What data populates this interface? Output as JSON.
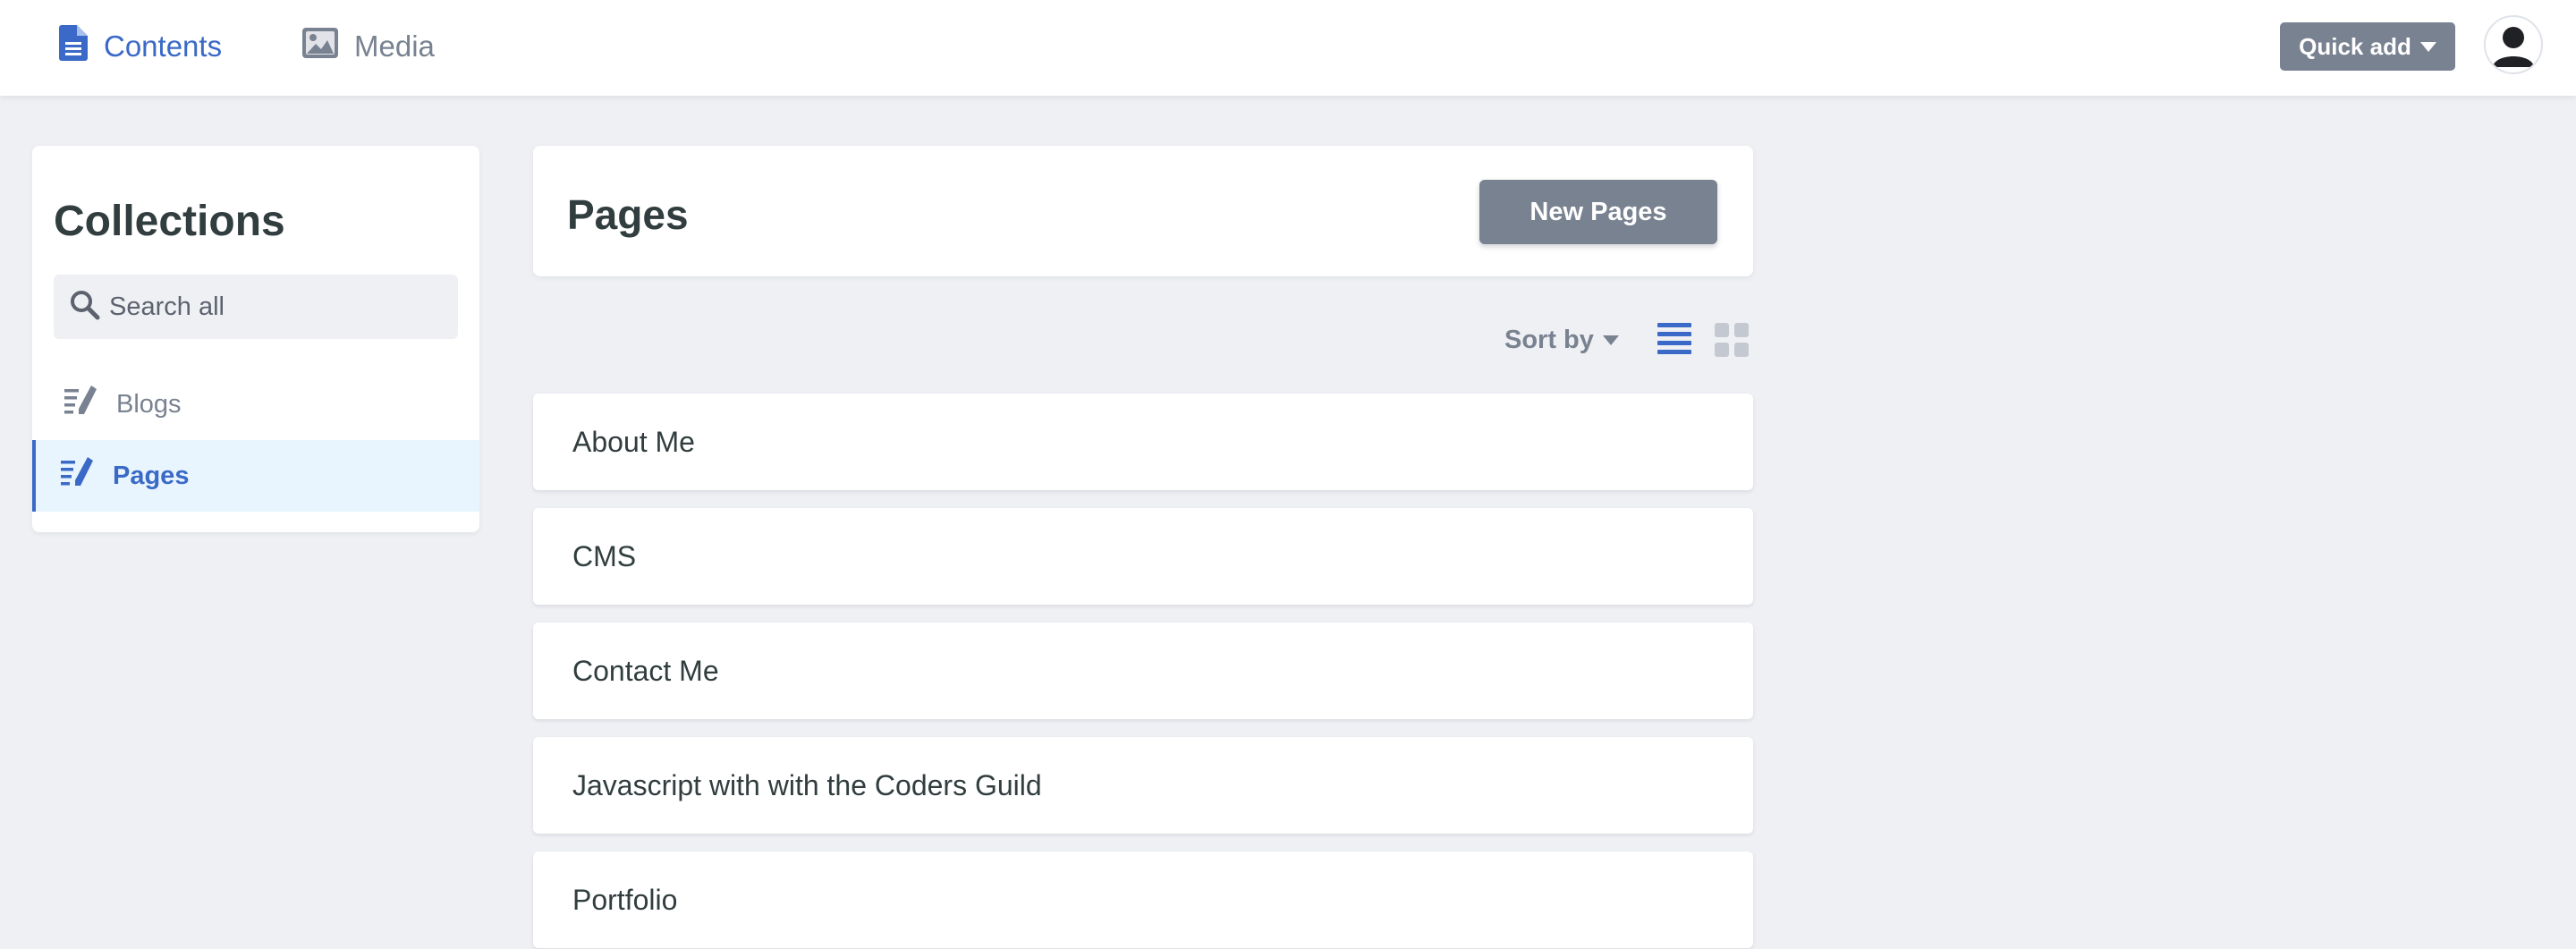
{
  "topbar": {
    "nav": [
      {
        "label": "Contents",
        "icon": "document-icon",
        "active": true
      },
      {
        "label": "Media",
        "icon": "image-icon",
        "active": false
      }
    ],
    "quick_add_label": "Quick add",
    "avatar_icon": "user-avatar-icon"
  },
  "sidebar": {
    "title": "Collections",
    "search_placeholder": "Search all",
    "items": [
      {
        "label": "Blogs",
        "icon": "collection-pen-icon",
        "active": false
      },
      {
        "label": "Pages",
        "icon": "collection-pen-icon",
        "active": true
      }
    ]
  },
  "main": {
    "title": "Pages",
    "new_button_label": "New Pages",
    "sort_label": "Sort by",
    "view_modes": [
      {
        "name": "list-view-icon",
        "active": true
      },
      {
        "name": "grid-view-icon",
        "active": false
      }
    ],
    "entries": [
      "About Me",
      "CMS",
      "Contact Me",
      "Javascript with with the Coders Guild",
      "Portfolio"
    ]
  },
  "colors": {
    "accent": "#3a69c7",
    "muted": "#798291",
    "background": "#eff0f4",
    "active_item_bg": "#e8f5fe",
    "text": "#313d3e"
  }
}
